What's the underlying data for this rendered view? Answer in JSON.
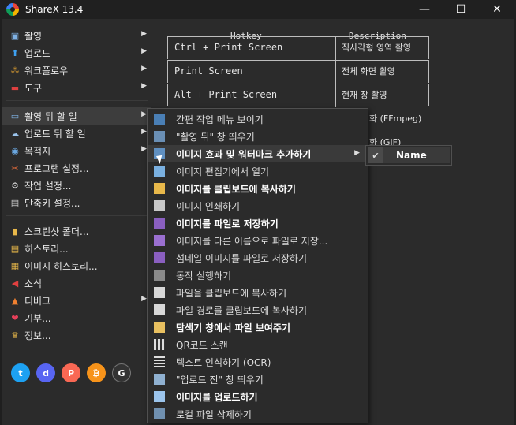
{
  "window": {
    "title": "ShareX 13.4",
    "minimize_glyph": "—",
    "maximize_glyph": "☐",
    "close_glyph": "✕"
  },
  "left_menu": {
    "items": [
      {
        "label": "촬영",
        "icon": "camera-icon",
        "arrow": "▶"
      },
      {
        "label": "업로드",
        "icon": "upload-icon",
        "arrow": "▶"
      },
      {
        "label": "워크플로우",
        "icon": "workflow-icon",
        "arrow": "▶"
      },
      {
        "label": "도구",
        "icon": "toolbox-icon",
        "arrow": "▶"
      },
      {
        "label": "촬영 뒤 할 일",
        "icon": "after-capture-icon",
        "arrow": "▶"
      },
      {
        "label": "업로드 뒤 할 일",
        "icon": "after-upload-icon",
        "arrow": "▶"
      },
      {
        "label": "목적지",
        "icon": "destination-icon",
        "arrow": "▶"
      },
      {
        "label": "프로그램 설정...",
        "icon": "app-settings-icon"
      },
      {
        "label": "작업 설정...",
        "icon": "task-settings-icon"
      },
      {
        "label": "단축키 설정...",
        "icon": "hotkey-settings-icon"
      },
      {
        "label": "스크린샷 폴더...",
        "icon": "folder-icon"
      },
      {
        "label": "히스토리...",
        "icon": "history-icon"
      },
      {
        "label": "이미지 히스토리...",
        "icon": "image-history-icon"
      },
      {
        "label": "소식",
        "icon": "news-icon"
      },
      {
        "label": "디버그",
        "icon": "debug-icon",
        "arrow": "▶"
      },
      {
        "label": "기부...",
        "icon": "heart-icon"
      },
      {
        "label": "정보...",
        "icon": "crown-icon"
      }
    ]
  },
  "hotkeys": {
    "header_key": "Hotkey",
    "header_desc": "Description",
    "rows": [
      {
        "key": "Ctrl + Print Screen",
        "desc": "직사각형 영역 촬영"
      },
      {
        "key": "Print Screen",
        "desc": "전체 화면 촬영"
      },
      {
        "key": "Alt + Print Screen",
        "desc": "현재 창 촬영"
      }
    ],
    "partial": [
      "화 (FFmpeg)",
      "화 (GIF)"
    ]
  },
  "submenu": {
    "items": [
      {
        "label": "간편 작업 메뉴 보이기",
        "bold": false,
        "icon": "quick-menu-icon"
      },
      {
        "label": "\"촬영 뒤\" 창 띄우기",
        "bold": false,
        "icon": "after-window-icon"
      },
      {
        "label": "이미지 효과 및 워터마크 추가하기",
        "bold": true,
        "icon": "effects-icon",
        "arrow": "▶"
      },
      {
        "label": "이미지 편집기에서 열기",
        "bold": false,
        "icon": "editor-icon"
      },
      {
        "label": "이미지를 클립보드에 복사하기",
        "bold": true,
        "icon": "clipboard-image-icon"
      },
      {
        "label": "이미지 인쇄하기",
        "bold": false,
        "icon": "print-icon"
      },
      {
        "label": "이미지를 파일로 저장하기",
        "bold": true,
        "icon": "save-icon"
      },
      {
        "label": "이미지를 다른 이름으로 파일로 저장...",
        "bold": false,
        "icon": "save-as-icon"
      },
      {
        "label": "섬네일 이미지를 파일로 저장하기",
        "bold": false,
        "icon": "thumbnail-icon"
      },
      {
        "label": "동작 실행하기",
        "bold": false,
        "icon": "action-icon"
      },
      {
        "label": "파일을 클립보드에 복사하기",
        "bold": false,
        "icon": "clipboard-file-icon"
      },
      {
        "label": "파일 경로를 클립보드에 복사하기",
        "bold": false,
        "icon": "clipboard-path-icon"
      },
      {
        "label": "탐색기 창에서 파일 보여주기",
        "bold": true,
        "icon": "explorer-icon"
      },
      {
        "label": "QR코드 스캔",
        "bold": false,
        "icon": "qr-icon"
      },
      {
        "label": "텍스트 인식하기 (OCR)",
        "bold": false,
        "icon": "ocr-icon"
      },
      {
        "label": "\"업로드 전\" 창 띄우기",
        "bold": false,
        "icon": "before-upload-icon"
      },
      {
        "label": "이미지를 업로드하기",
        "bold": true,
        "icon": "cloud-upload-icon"
      },
      {
        "label": "로컬 파일 삭제하기",
        "bold": false,
        "icon": "delete-icon"
      }
    ]
  },
  "submenu2": {
    "label": "Name",
    "checked": true,
    "check_glyph": "✔"
  },
  "social": [
    {
      "name": "twitter-icon",
      "glyph": "t",
      "color": "#1da1f2"
    },
    {
      "name": "discord-icon",
      "glyph": "d",
      "color": "#5865f2"
    },
    {
      "name": "patreon-icon",
      "glyph": "P",
      "color": "#f96854"
    },
    {
      "name": "bitcoin-icon",
      "glyph": "₿",
      "color": "#f7931a"
    },
    {
      "name": "github-icon",
      "glyph": "G",
      "color": "#333333"
    }
  ]
}
